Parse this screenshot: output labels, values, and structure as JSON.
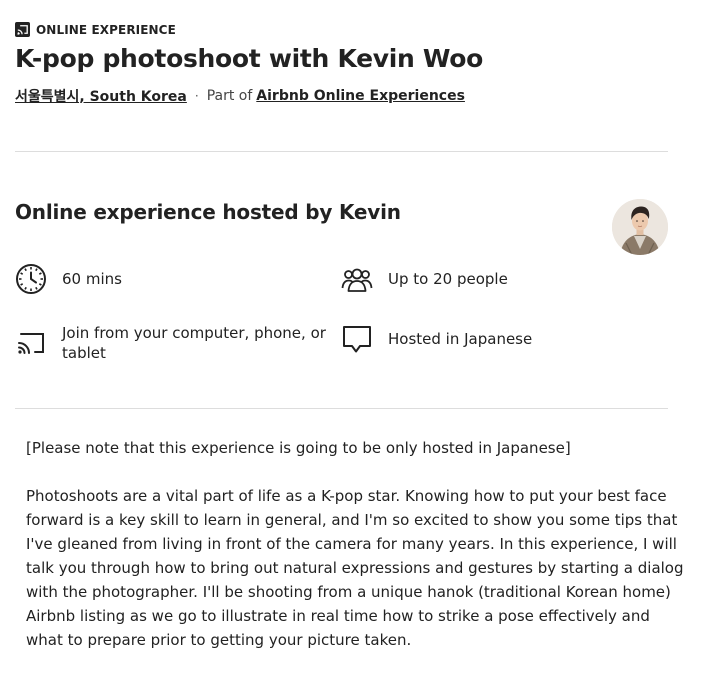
{
  "header": {
    "badge_label": "ONLINE EXPERIENCE",
    "title": "K-pop photoshoot with Kevin Woo",
    "location_link": "서울특별시, South Korea",
    "separator": "·",
    "part_of_text": "Part of",
    "collection_link": "Airbnb Online Experiences"
  },
  "host_section": {
    "title": "Online experience hosted by Kevin",
    "avatar_alt": "Kevin",
    "features": [
      {
        "icon": "clock-icon",
        "label": "60 mins"
      },
      {
        "icon": "group-icon",
        "label": "Up to 20 people"
      },
      {
        "icon": "devices-icon",
        "label": "Join from your computer, phone, or tablet"
      },
      {
        "icon": "chat-bubble-icon",
        "label": "Hosted in Japanese"
      }
    ]
  },
  "description": {
    "note": "[Please note that this experience is going to be only hosted in Japanese]",
    "body": "Photoshoots are a vital part of life as a K-pop star. Knowing how to put your best face forward is a key skill to learn in general, and I'm so excited to show you some tips that I've gleaned from living in front of the camera for many years. In this experience, I will talk you through how to bring out natural expressions and gestures by starting a dialog with the photographer. I'll be shooting from a unique hanok (traditional Korean home) Airbnb listing as we go to illustrate in real time how to strike a pose effectively and what to prepare prior to getting your picture taken."
  },
  "colors": {
    "text": "#222222",
    "divider": "#dddddd",
    "background": "#ffffff"
  }
}
